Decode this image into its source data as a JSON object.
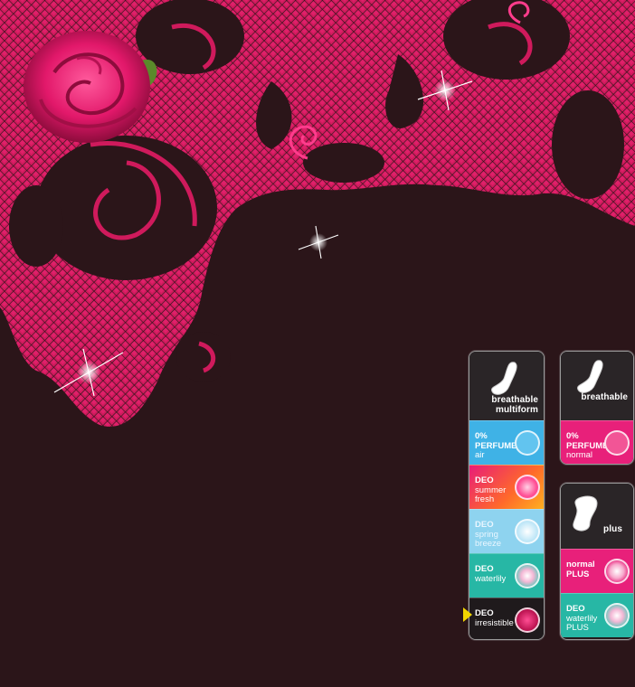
{
  "colors": {
    "background": "#2b1519",
    "lace": "#d4145a",
    "air": "#3fb2e6",
    "summer": "#ff6a2a",
    "spring": "#8ed3ef",
    "waterlily": "#27b7a5",
    "irresistible": "#1f1a1c",
    "normal": "#e8207a",
    "selected_marker": "#f2d500"
  },
  "panel_left": {
    "header": {
      "line1": "breathable",
      "line2": "multiform"
    },
    "rows": [
      {
        "id": "air",
        "l1": "0%",
        "l2": "PERFUME",
        "l3": "air",
        "icon": "circle-zero-icon"
      },
      {
        "id": "summer",
        "l1": "DEO",
        "l2": "summer",
        "l3": "fresh",
        "icon": "flower-icon"
      },
      {
        "id": "spring",
        "l1": "DEO",
        "l2": "spring",
        "l3": "breeze",
        "icon": "blossom-icon"
      },
      {
        "id": "waterlily",
        "l1": "DEO",
        "l2": "waterlily",
        "l3": "",
        "icon": "waterlily-icon"
      },
      {
        "id": "irresistible",
        "l1": "DEO",
        "l2": "irresistible",
        "l3": "",
        "icon": "rose-icon",
        "selected": true
      }
    ]
  },
  "panel_right_top": {
    "header": {
      "line1": "breathable"
    },
    "rows": [
      {
        "id": "normal",
        "l1": "0%",
        "l2": "PERFUME",
        "l3": "normal",
        "icon": "circle-zero-icon"
      }
    ]
  },
  "panel_right_bottom": {
    "header": {
      "line1": "plus"
    },
    "rows": [
      {
        "id": "normal-plus",
        "l1": "normal",
        "l2": "PLUS",
        "l3": "",
        "icon": "orchid-icon"
      },
      {
        "id": "waterlily-plus",
        "l1": "DEO",
        "l2": "waterlily",
        "l3": "PLUS",
        "icon": "waterlily-icon"
      }
    ]
  }
}
